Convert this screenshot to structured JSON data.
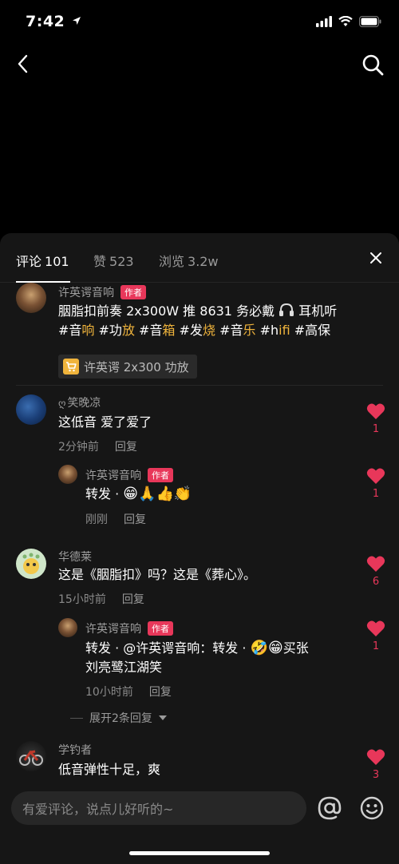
{
  "status_bar": {
    "time": "7:42"
  },
  "panel": {
    "tabs": [
      {
        "label": "评论",
        "count": "101"
      },
      {
        "label": "赞",
        "count": "523"
      },
      {
        "label": "浏览",
        "count": "3.2w"
      }
    ]
  },
  "comments": {
    "pinned": {
      "username": "许英谔音响",
      "badge": "作者",
      "line1": "胭脂扣前奏 2x300W 推 8631 务必戴",
      "line1_tail": "耳机听",
      "line2_parts": [
        "#音",
        "响",
        " #功",
        "放",
        " #音",
        "箱",
        " #发",
        "烧",
        " #音",
        "乐",
        " #h",
        "ifi",
        " #高保"
      ],
      "product": "许英谔 2x300 功放"
    },
    "c1": {
      "username": "笑晚凉",
      "text": "这低音 爱了爱了",
      "time": "2分钟前",
      "reply": "回复",
      "likes": "1",
      "reply_item": {
        "username": "许英谔音响",
        "badge": "作者",
        "text": "转发 ·",
        "time": "刚刚",
        "reply": "回复",
        "likes": "1"
      }
    },
    "c2": {
      "username": "华德莱",
      "text": "这是《胭脂扣》吗？这是《葬心》。",
      "time": "15小时前",
      "reply": "回复",
      "likes": "6",
      "reply_item": {
        "username": "许英谔音响",
        "badge": "作者",
        "text_line1": "转发 · @许英谔音响：转发 ·",
        "text_line1_tail": "买张",
        "text_line2": "刘亮鹭江湖笑",
        "time": "10小时前",
        "reply": "回复",
        "likes": "1"
      },
      "expand": "展开2条回复"
    },
    "c3": {
      "username": "学钓者",
      "text": "低音弹性十足，爽",
      "likes": "3"
    }
  },
  "input": {
    "placeholder": "有爱评论，说点儿好听的~"
  },
  "colors": {
    "accent": "#e8375a",
    "highlight": "#f0b43c",
    "panel_bg": "#161616"
  }
}
